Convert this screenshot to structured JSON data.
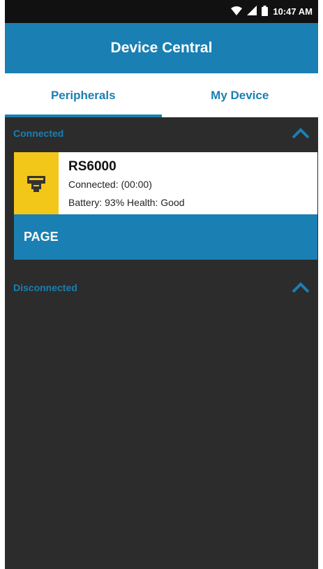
{
  "status_bar": {
    "time": "10:47 AM"
  },
  "app_bar": {
    "title": "Device Central"
  },
  "tabs": [
    {
      "label": "Peripherals",
      "active": true
    },
    {
      "label": "My Device",
      "active": false
    }
  ],
  "sections": {
    "connected": {
      "label": "Connected",
      "devices": [
        {
          "name": "RS6000",
          "status": "Connected: (00:00)",
          "battery": "Battery: 93% Health: Good",
          "action_label": "PAGE"
        }
      ]
    },
    "disconnected": {
      "label": "Disconnected"
    }
  },
  "colors": {
    "accent": "#1a7fb2",
    "device_icon_bg": "#f3c61a",
    "background": "#2c2c2c"
  },
  "icons": [
    "wifi-icon",
    "signal-icon",
    "battery-icon",
    "scanner-device-icon",
    "chevron-up-icon"
  ]
}
